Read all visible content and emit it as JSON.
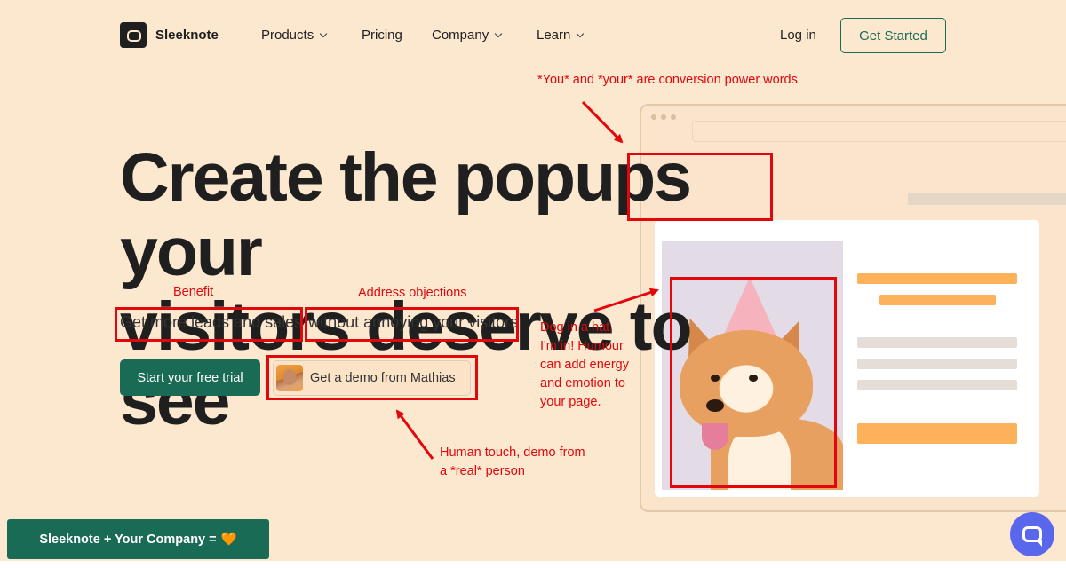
{
  "nav": {
    "brand": "Sleeknote",
    "items": [
      {
        "label": "Products",
        "dropdown": true
      },
      {
        "label": "Pricing",
        "dropdown": false
      },
      {
        "label": "Company",
        "dropdown": true
      },
      {
        "label": "Learn",
        "dropdown": true
      }
    ],
    "login": "Log in",
    "cta": "Get Started"
  },
  "hero": {
    "headline_line1_a": "Create the popups",
    "headline_line1_b": "your",
    "headline_line2": "visitors deserve to see",
    "sub_a": "Get more leads and sales",
    "sub_b": "without annoying your visitors.",
    "primary_cta": "Start your free trial",
    "demo_cta": "Get a demo from Mathias"
  },
  "annotations": {
    "power_words": "*You* and *your* are conversion power words",
    "benefit": "Benefit",
    "objections": "Address objections",
    "dog_line1": "Dog in a hat.",
    "dog_line2": "I'm in! Humour",
    "dog_line3": "can add energy",
    "dog_line4": "and emotion to",
    "dog_line5": "your page.",
    "human_line1": "Human touch, demo from",
    "human_line2": "a *real* person"
  },
  "banner": {
    "text": "Sleeknote + Your Company =",
    "heart": "🧡"
  },
  "colors": {
    "background": "#fce7cf",
    "brand_green": "#1a6b55",
    "annotation_red": "#e3070c",
    "popup_orange": "#fdb15b",
    "chat_blue": "#5967ec"
  },
  "icons": [
    "sleeknote-logo-icon",
    "chevron-down-icon",
    "chat-bubble-icon",
    "heart-icon"
  ]
}
